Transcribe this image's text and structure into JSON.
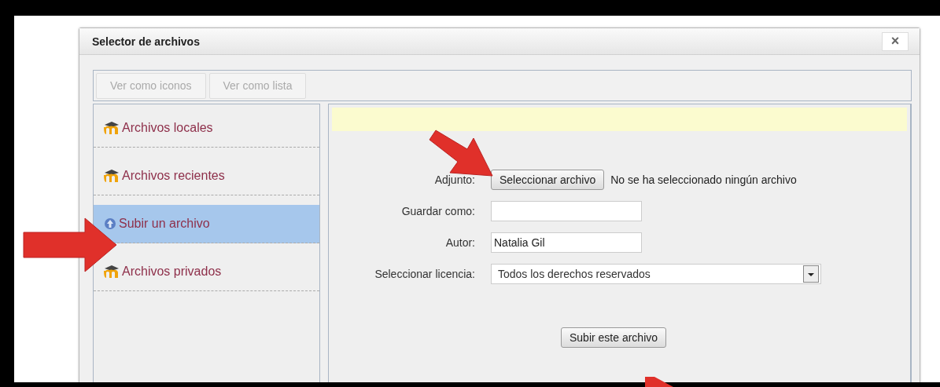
{
  "dialog": {
    "title": "Selector de archivos",
    "close": "×"
  },
  "toolbar": [
    {
      "label": "Ver como iconos",
      "disabled": true
    },
    {
      "label": "Ver como lista",
      "disabled": true
    }
  ],
  "sidebar": {
    "items": [
      {
        "label": "Archivos locales",
        "kind": "repository",
        "selected": false
      },
      {
        "label": "Archivos recientes",
        "kind": "repository",
        "selected": false
      },
      {
        "label": "Subir un archivo",
        "kind": "upload",
        "selected": true
      },
      {
        "label": "Archivos privados",
        "kind": "repository",
        "selected": false
      }
    ]
  },
  "form": {
    "attachment": {
      "label": "Adjunto:",
      "button": "Seleccionar archivo",
      "status": "No se ha seleccionado ningún archivo"
    },
    "save_as": {
      "label": "Guardar como:"
    },
    "author": {
      "label": "Autor:",
      "value": "Natalia Gil"
    },
    "license": {
      "label": "Seleccionar licencia:",
      "value": "Todos los derechos reservados"
    },
    "submit": "Subir este archivo"
  }
}
